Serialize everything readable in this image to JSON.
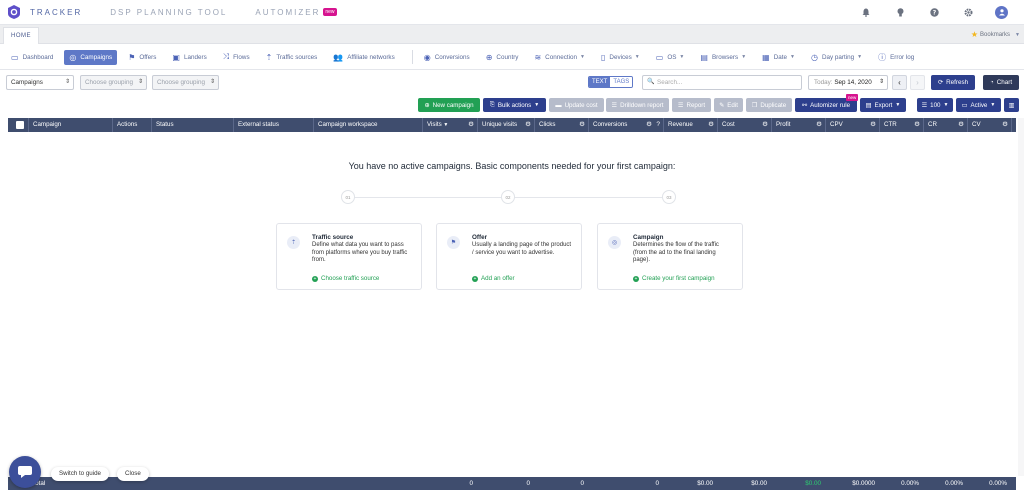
{
  "topnav": {
    "items": [
      {
        "label": "TRACKER",
        "active": true
      },
      {
        "label": "DSP PLANNING TOOL",
        "active": false
      },
      {
        "label": "AUTOMIZER",
        "active": false,
        "badge": "new"
      }
    ],
    "icons": [
      "bell-icon",
      "lightbulb-icon",
      "help-icon",
      "gear-icon",
      "avatar"
    ]
  },
  "tabs": {
    "home": "HOME",
    "bookmarks": "Bookmarks"
  },
  "sections": [
    {
      "label": "Dashboard",
      "icon": "monitor-icon",
      "active": false
    },
    {
      "label": "Campaigns",
      "icon": "target-icon",
      "active": true
    },
    {
      "label": "Offers",
      "icon": "flag-icon",
      "active": false
    },
    {
      "label": "Landers",
      "icon": "image-icon",
      "active": false
    },
    {
      "label": "Flows",
      "icon": "shuffle-icon",
      "active": false
    },
    {
      "label": "Traffic sources",
      "icon": "upload-icon",
      "active": false
    },
    {
      "label": "Affiliate networks",
      "icon": "users-icon",
      "active": false
    },
    {
      "label": "Conversions",
      "icon": "conversion-icon",
      "active": false
    },
    {
      "label": "Country",
      "icon": "globe-icon",
      "active": false
    },
    {
      "label": "Connection",
      "icon": "wifi-icon",
      "active": false,
      "dropdown": true
    },
    {
      "label": "Devices",
      "icon": "devices-icon",
      "active": false,
      "dropdown": true
    },
    {
      "label": "OS",
      "icon": "desktop-icon",
      "active": false,
      "dropdown": true
    },
    {
      "label": "Browsers",
      "icon": "browser-icon",
      "active": false,
      "dropdown": true
    },
    {
      "label": "Date",
      "icon": "calendar-icon",
      "active": false,
      "dropdown": true
    },
    {
      "label": "Day parting",
      "icon": "clock-icon",
      "active": false,
      "dropdown": true
    },
    {
      "label": "Error log",
      "icon": "info-icon",
      "active": false
    }
  ],
  "filters": {
    "grouping1": "Campaigns",
    "grouping2_placeholder": "Choose grouping",
    "grouping3_placeholder": "Choose grouping",
    "text_toggle": "TEXT",
    "tags_toggle": "TAGS",
    "search_placeholder": "Search...",
    "date_label": "Today:",
    "date_value": "Sep 14, 2020",
    "refresh": "Refresh",
    "chart": "Chart"
  },
  "actions": {
    "new_campaign": "New campaign",
    "bulk_actions": "Bulk actions",
    "update_cost": "Update cost",
    "drilldown_report": "Drilldown report",
    "report": "Report",
    "edit": "Edit",
    "duplicate": "Duplicate",
    "automizer_rule": "Automizer rule",
    "automizer_badge": "new",
    "export": "Export",
    "page_size": "100",
    "status_filter": "Active"
  },
  "table": {
    "columns": [
      "Campaign",
      "Actions",
      "Status",
      "External status",
      "Campaign workspace",
      "Visits",
      "Unique visits",
      "Clicks",
      "Conversions",
      "Revenue",
      "Cost",
      "Profit",
      "CPV",
      "CTR",
      "CR",
      "CV",
      "RO"
    ]
  },
  "empty_state": {
    "title": "You have no active campaigns. Basic components needed for your first campaign:",
    "steps": [
      "01",
      "02",
      "03"
    ],
    "cards": [
      {
        "title": "Traffic source",
        "desc": "Define what data you want to pass from platforms where you buy traffic from.",
        "link": "Choose traffic source"
      },
      {
        "title": "Offer",
        "desc": "Usually a landing page of the product / service you want to advertise.",
        "link": "Add an offer"
      },
      {
        "title": "Campaign",
        "desc": "Determines the flow of the traffic (from the ad to the final landing page).",
        "link": "Create your first campaign"
      }
    ]
  },
  "footer": {
    "label": "Total",
    "visits": "0",
    "unique_visits": "0",
    "clicks": "0",
    "conversions": "0",
    "revenue": "$0.00",
    "cost": "$0.00",
    "profit": "$0.00",
    "cpv": "$0.0000",
    "ctr": "0.00%",
    "cr": "0.00%",
    "cv": "0.00%"
  },
  "chat": {
    "switch_guide": "Switch to guide",
    "close": "Close"
  },
  "colors": {
    "accent": "#5e78c7",
    "navy": "#2d3f8d",
    "green": "#22a054",
    "header": "#3f4d6e",
    "badge": "#d6148f"
  }
}
